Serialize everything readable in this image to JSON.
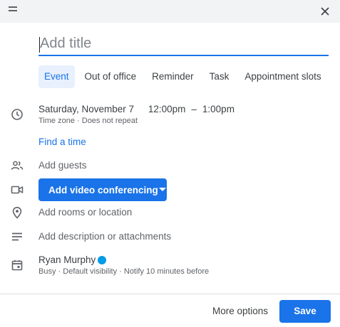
{
  "dialog": {
    "title_placeholder": "Add title",
    "tabs": [
      {
        "label": "Event",
        "active": true
      },
      {
        "label": "Out of office",
        "active": false
      },
      {
        "label": "Reminder",
        "active": false
      },
      {
        "label": "Task",
        "active": false
      },
      {
        "label": "Appointment slots",
        "active": false
      }
    ],
    "datetime": {
      "date": "Saturday, November 7",
      "start": "12:00pm",
      "separator": "–",
      "end": "1:00pm",
      "timezone": "Time zone",
      "dot": "·",
      "repeat": "Does not repeat"
    },
    "find_time": "Find a time",
    "guests": "Add guests",
    "video_button": "Add video conferencing",
    "location": "Add rooms or location",
    "description": "Add description or attachments",
    "owner": {
      "name": "Ryan Murphy",
      "color": "#039be5",
      "status": "Busy",
      "dot": "·",
      "visibility": "Default visibility",
      "notify": "Notify 10 minutes before"
    },
    "footer": {
      "more_options": "More options",
      "save": "Save"
    }
  },
  "colors": {
    "accent": "#1a73e8",
    "topbar": "#f1f3f4",
    "tab_active_bg": "#e8f0fe"
  },
  "icons": [
    "drag-handle-icon",
    "close-icon",
    "clock-icon",
    "people-icon",
    "videocam-icon",
    "location-pin-icon",
    "notes-icon",
    "calendar-icon",
    "dropdown-arrow-icon"
  ]
}
